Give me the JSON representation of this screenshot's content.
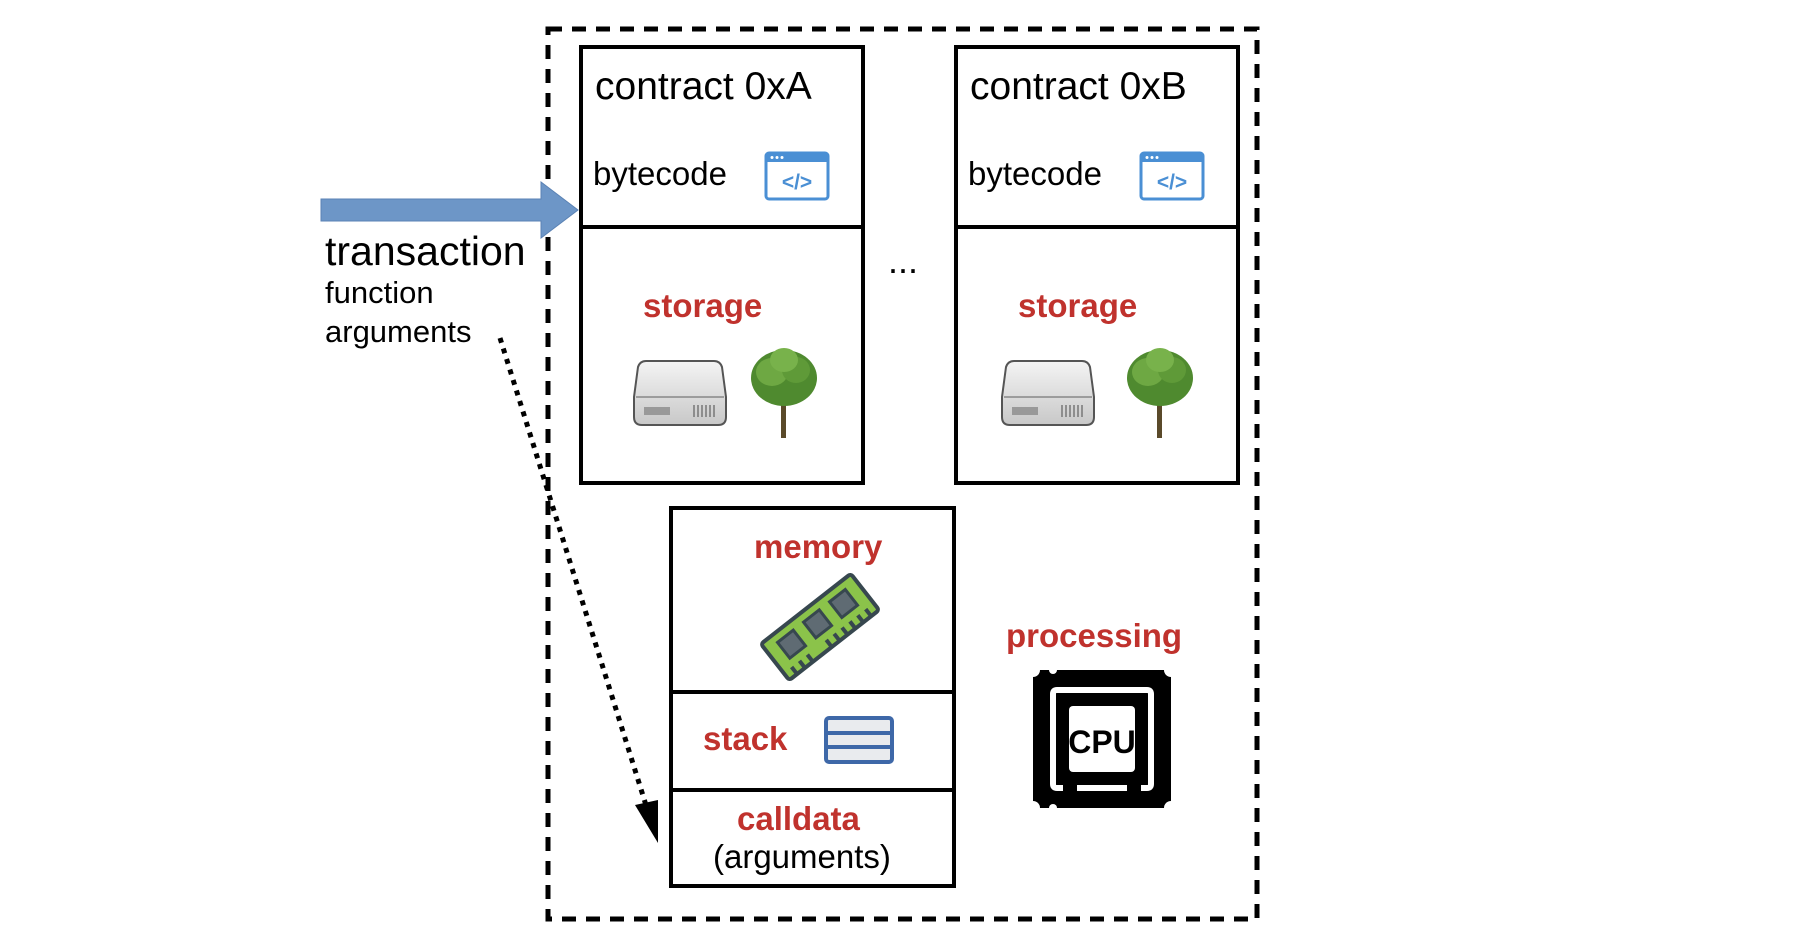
{
  "colors": {
    "accent_red": "#c0322d",
    "arrow_blue": "#6d96c7",
    "border_black": "#000000",
    "code_icon_blue": "#4a8fd4",
    "stack_icon_blue": "#3e68a8",
    "ram_green": "#8bc34a"
  },
  "transaction": {
    "title": "transaction",
    "line2": "function",
    "line3": "arguments",
    "arrow_icon": "block-arrow-right-icon",
    "pointer_icon": "dotted-arrow-icon"
  },
  "world_state": {
    "contracts": [
      {
        "title": "contract 0xA",
        "bytecode_label": "bytecode",
        "bytecode_icon": "code-window-icon",
        "storage_label": "storage",
        "storage_icons": [
          "hard-drive-icon",
          "tree-icon"
        ]
      },
      {
        "title": "contract 0xB",
        "bytecode_label": "bytecode",
        "bytecode_icon": "code-window-icon",
        "storage_label": "storage",
        "storage_icons": [
          "hard-drive-icon",
          "tree-icon"
        ]
      }
    ],
    "ellipsis": "..."
  },
  "execution": {
    "memory_label": "memory",
    "memory_icon": "ram-stick-icon",
    "stack_label": "stack",
    "stack_icon": "stack-layers-icon",
    "calldata_label": "calldata",
    "calldata_sub": "(arguments)",
    "processing_label": "processing",
    "processing_icon": "cpu-chip-icon",
    "cpu_text": "CPU"
  }
}
